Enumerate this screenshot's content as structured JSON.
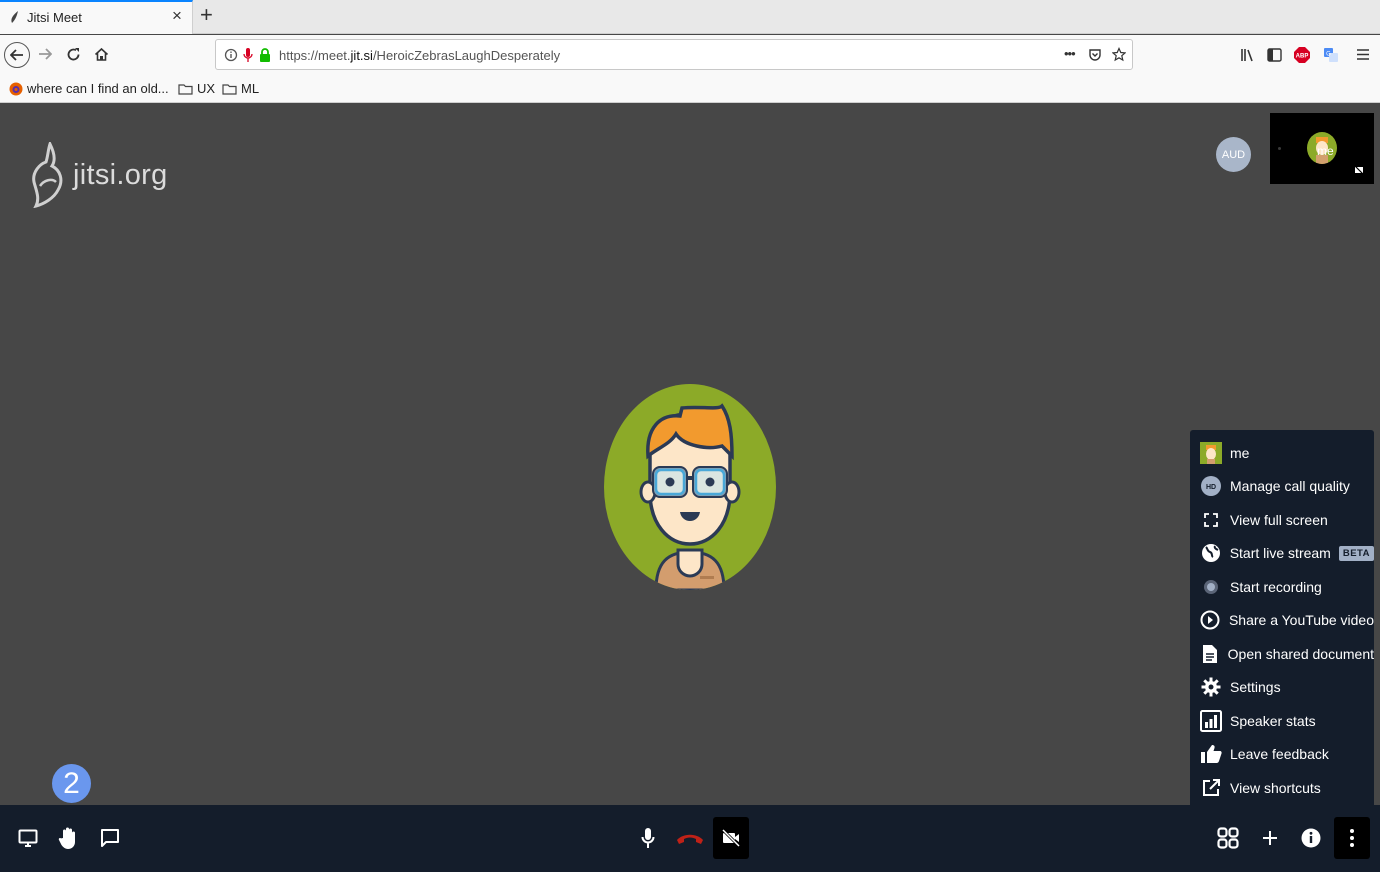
{
  "browser": {
    "tab_title": "Jitsi Meet",
    "tab_close": "×",
    "new_tab": "+",
    "url_prefix": "https://meet.",
    "url_host": "jit.si",
    "url_path": "/HeroicZebrasLaughDesperately",
    "url_more": "•••",
    "bookmarks": [
      {
        "label": "where can I find an old..."
      },
      {
        "label": "UX"
      },
      {
        "label": "ML"
      }
    ]
  },
  "stage": {
    "watermark_text": "jitsi.org",
    "aud_label": "AUD",
    "local_thumb_label": "me",
    "raise_hand_count": "2"
  },
  "menu": {
    "items": [
      {
        "label": "me",
        "icon": "user-avatar-icon"
      },
      {
        "label": "Manage call quality",
        "icon": "hd-icon"
      },
      {
        "label": "View full screen",
        "icon": "fullscreen-icon"
      },
      {
        "label": "Start live stream",
        "icon": "globe-icon",
        "badge": "BETA"
      },
      {
        "label": "Start recording",
        "icon": "record-icon"
      },
      {
        "label": "Share a YouTube video",
        "icon": "play-circle-icon"
      },
      {
        "label": "Open shared document",
        "icon": "document-icon"
      },
      {
        "label": "Settings",
        "icon": "gear-icon"
      },
      {
        "label": "Speaker stats",
        "icon": "bar-chart-icon"
      },
      {
        "label": "Leave feedback",
        "icon": "thumbs-up-icon"
      },
      {
        "label": "View shortcuts",
        "icon": "external-link-icon"
      }
    ]
  },
  "toolbar": {
    "left": [
      "screen-share-icon",
      "raise-hand-icon",
      "chat-icon"
    ],
    "center": [
      "microphone-icon",
      "hangup-icon",
      "camera-off-icon"
    ],
    "right": [
      "tile-view-icon",
      "invite-icon",
      "info-icon",
      "more-icon"
    ]
  },
  "colors": {
    "stage": "#474747",
    "toolbar": "#141d2b",
    "avatar_green": "#8caa28",
    "hangup": "#bf2117",
    "badge": "#6a97ee"
  }
}
